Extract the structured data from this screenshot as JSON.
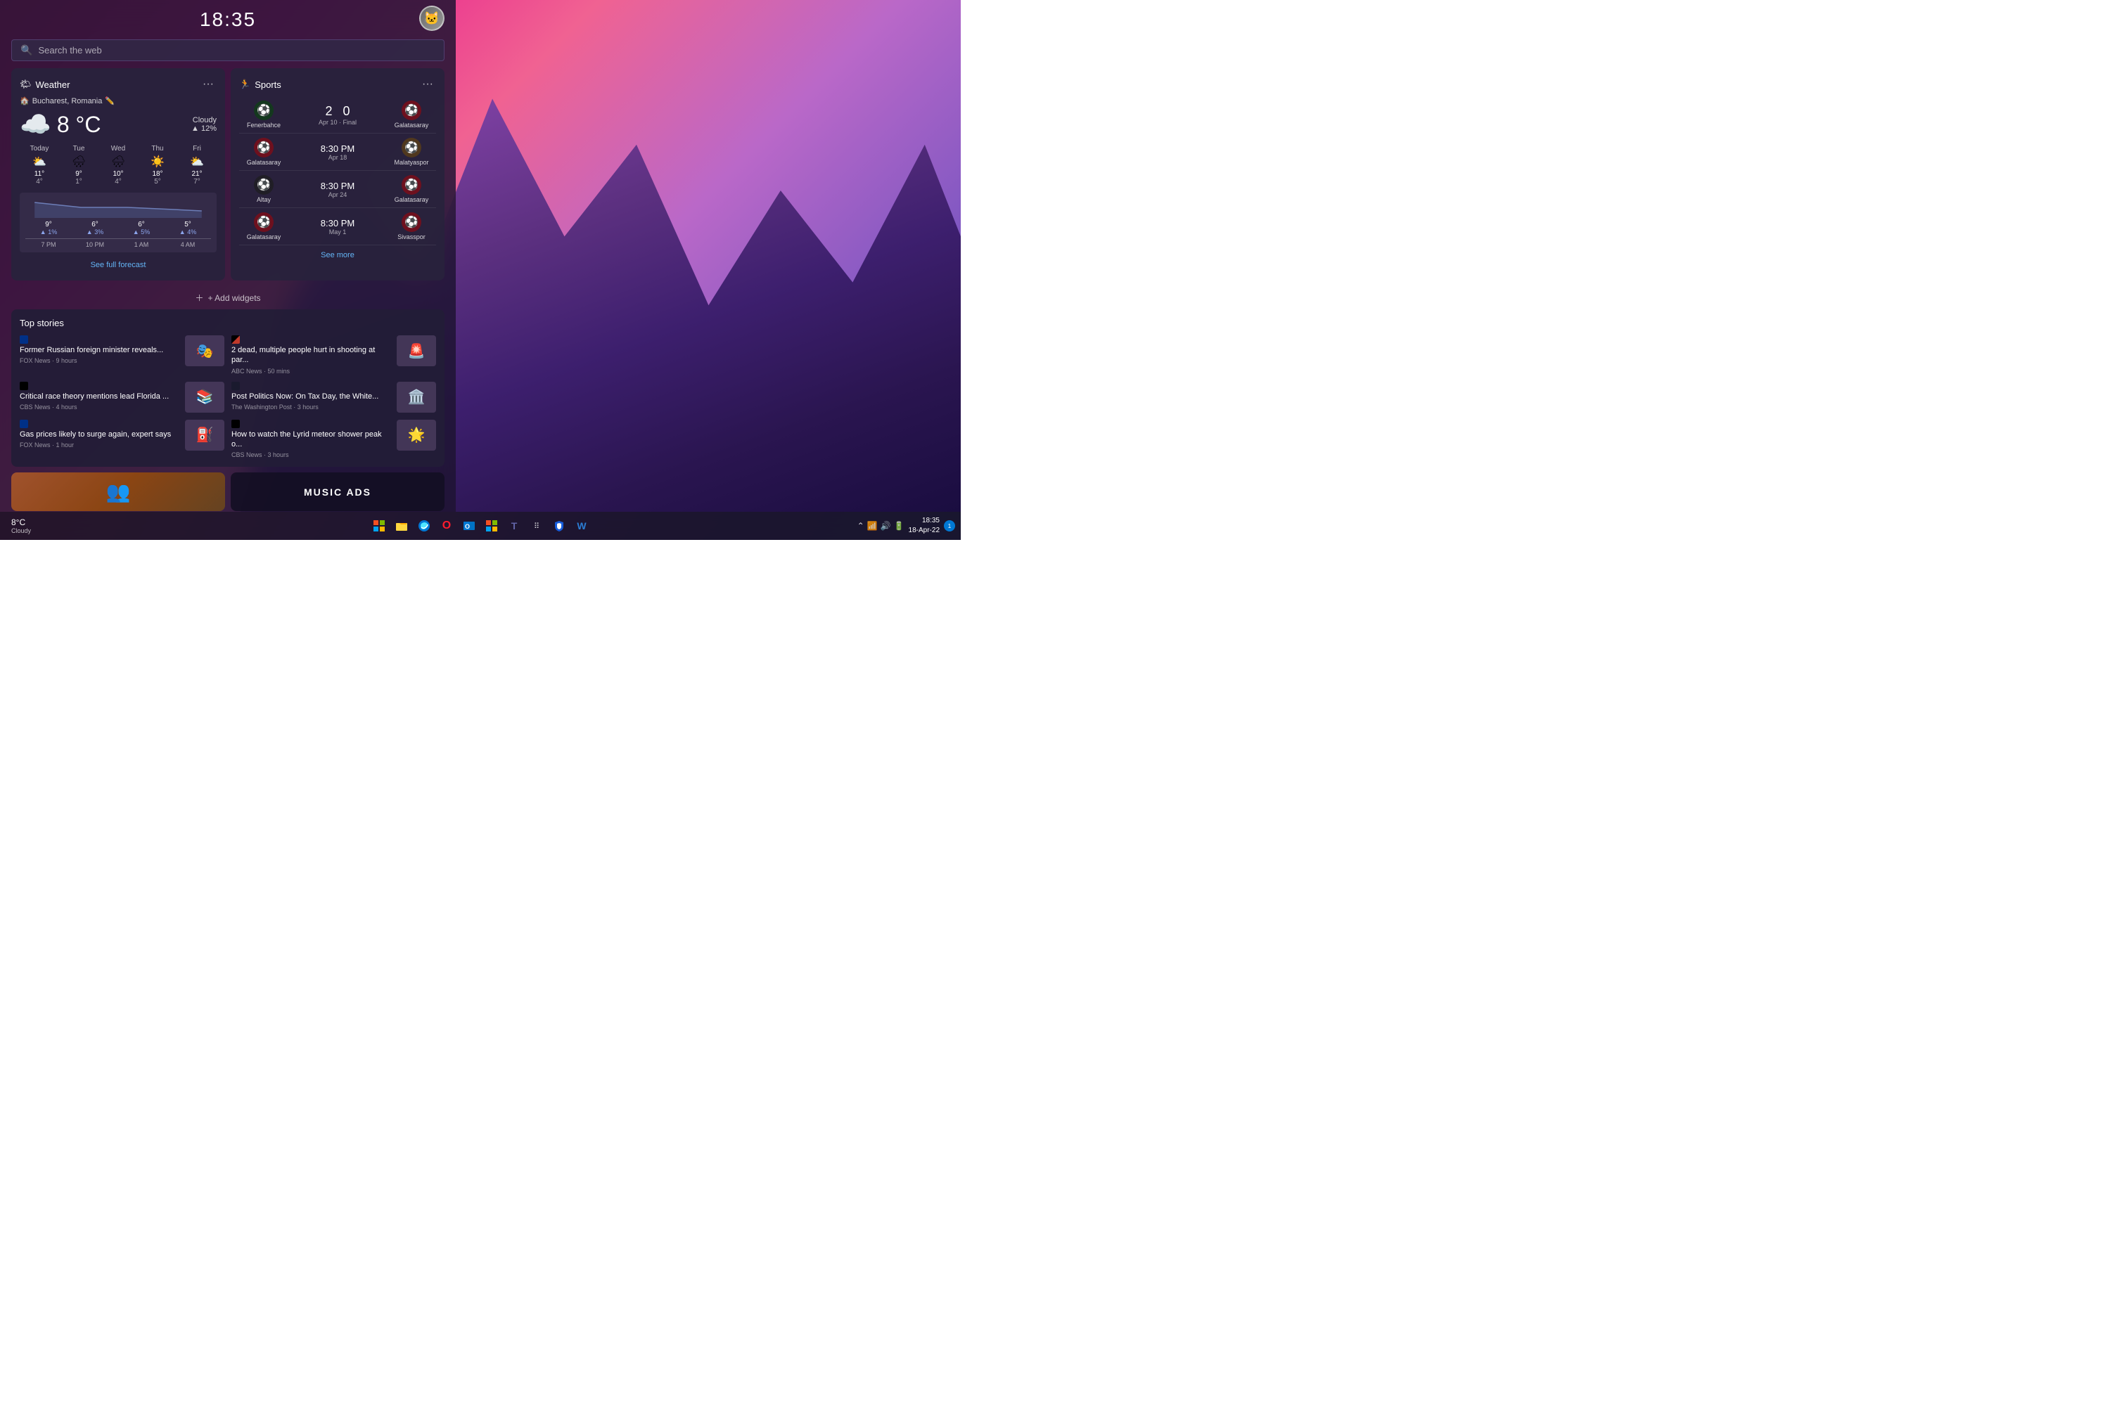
{
  "header": {
    "time": "18:35",
    "search_placeholder": "Search the web"
  },
  "weather": {
    "title": "Weather",
    "location": "Bucharest, Romania",
    "temp": "8",
    "unit": "°C",
    "condition": "Cloudy",
    "rain_pct": "▲ 12%",
    "forecast": [
      {
        "day": "Today",
        "icon": "⛅",
        "hi": "11°",
        "lo": "4°"
      },
      {
        "day": "Tue",
        "icon": "🌧",
        "hi": "9°",
        "lo": "1°"
      },
      {
        "day": "Wed",
        "icon": "🌧",
        "hi": "10°",
        "lo": "4°"
      },
      {
        "day": "Thu",
        "icon": "☀️",
        "hi": "18°",
        "lo": "5°"
      },
      {
        "day": "Fri",
        "icon": "⛅",
        "hi": "21°",
        "lo": "7°"
      }
    ],
    "hourly": [
      {
        "temp": "9°",
        "rain": "▲ 1%",
        "time": "7 PM"
      },
      {
        "temp": "6°",
        "rain": "▲ 3%",
        "time": "10 PM"
      },
      {
        "temp": "6°",
        "rain": "▲ 5%",
        "time": "1 AM"
      },
      {
        "temp": "5°",
        "rain": "▲ 4%",
        "time": "4 AM"
      }
    ],
    "see_full_forecast": "See full forecast"
  },
  "sports": {
    "title": "Sports",
    "matches": [
      {
        "home_team": "Fenerbahce",
        "home_logo": "🟡",
        "home_score": "2",
        "away_score": "0",
        "away_team": "Galatasaray",
        "away_logo": "🔴",
        "date": "Apr 10 · Final"
      },
      {
        "home_team": "Galatasaray",
        "home_logo": "🔴",
        "time": "8:30 PM",
        "date": "Apr 18",
        "away_team": "Malatyaspor",
        "away_logo": "🟡"
      },
      {
        "home_team": "Altay",
        "home_logo": "⚫",
        "time": "8:30 PM",
        "date": "Apr 24",
        "away_team": "Galatasaray",
        "away_logo": "🔴"
      },
      {
        "home_team": "Galatasaray",
        "home_logo": "🔴",
        "time": "8:30 PM",
        "date": "May 1",
        "away_team": "Sivasspor",
        "away_logo": "🔴"
      }
    ],
    "see_more": "See more"
  },
  "add_widgets": "+ Add widgets",
  "top_stories": {
    "title": "Top stories",
    "stories": [
      {
        "headline": "Former Russian foreign minister reveals...",
        "source": "FOX News",
        "time": "9 hours",
        "source_type": "fox",
        "image_emoji": "🎭"
      },
      {
        "headline": "2 dead, multiple people hurt in shooting at par...",
        "source": "ABC News",
        "time": "50 mins",
        "source_type": "abc",
        "image_emoji": "🚨"
      },
      {
        "headline": "Critical race theory mentions lead Florida ...",
        "source": "CBS News",
        "time": "4 hours",
        "source_type": "cbs",
        "image_emoji": "📚"
      },
      {
        "headline": "Post Politics Now: On Tax Day, the White...",
        "source": "The Washington Post",
        "time": "3 hours",
        "source_type": "wp",
        "image_emoji": "🏛️"
      },
      {
        "headline": "Gas prices likely to surge again, expert says",
        "source": "FOX News",
        "time": "1 hour",
        "source_type": "fox",
        "image_emoji": "⛽"
      },
      {
        "headline": "How to watch the Lyrid meteor shower peak o...",
        "source": "CBS News",
        "time": "3 hours",
        "source_type": "cbs",
        "image_emoji": "🌟"
      }
    ]
  },
  "taskbar": {
    "weather_temp": "8°C",
    "weather_cond": "Cloudy",
    "icons": [
      "⊞",
      "📁",
      "🌐",
      "🔴",
      "📧",
      "🛡",
      "W"
    ],
    "time": "18:35",
    "date": "18-Apr-22",
    "notification_count": "1"
  }
}
